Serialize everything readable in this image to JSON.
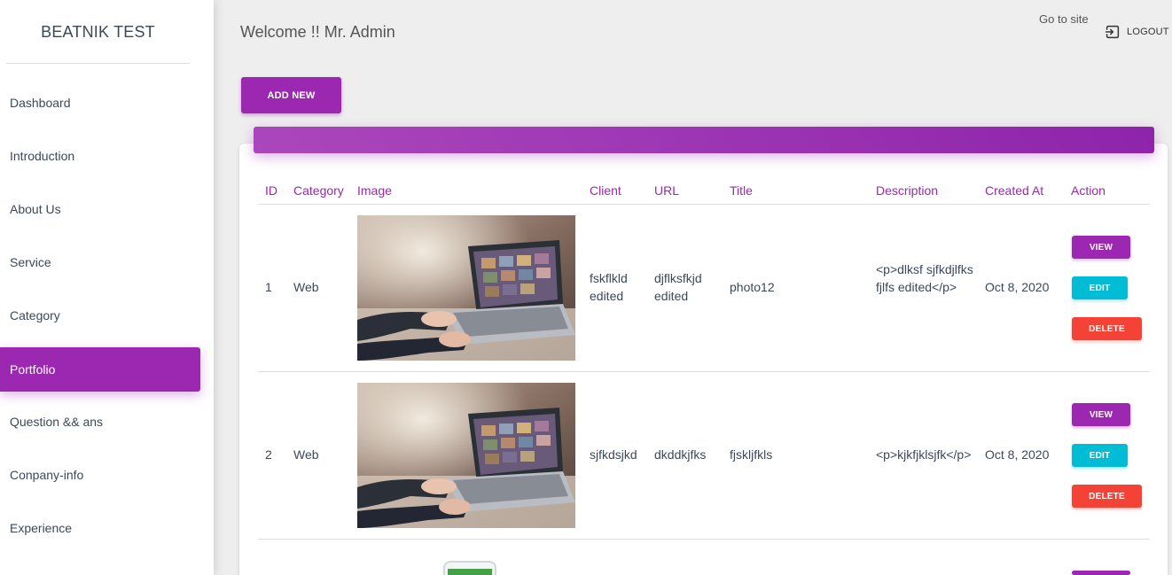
{
  "sidebar": {
    "brand": "BEATNIK TEST",
    "items": [
      {
        "label": "Dashboard"
      },
      {
        "label": "Introduction"
      },
      {
        "label": "About Us"
      },
      {
        "label": "Service"
      },
      {
        "label": "Category"
      },
      {
        "label": "Portfolio",
        "active": true
      },
      {
        "label": "Question && ans"
      },
      {
        "label": "Conpany-info"
      },
      {
        "label": "Experience"
      }
    ]
  },
  "header": {
    "welcome": "Welcome !! Mr. Admin",
    "goto_site": "Go to site",
    "logout": "LOGOUT"
  },
  "toolbar": {
    "add_new": "ADD NEW"
  },
  "table": {
    "columns": [
      "ID",
      "Category",
      "Image",
      "Client",
      "URL",
      "Title",
      "Description",
      "Created At",
      "Action"
    ],
    "rows": [
      {
        "id": "1",
        "category": "Web",
        "image": "laptop-photo",
        "client": "fskflkld edited",
        "url": "djflksfkjd edited",
        "title": "photo12",
        "description": "<p>dlksf sjfkdjlfks fjlfs edited</p>",
        "created_at": "Oct 8, 2020",
        "actions": {
          "view": "VIEW",
          "edit": "EDIT",
          "delete": "DELETE"
        }
      },
      {
        "id": "2",
        "category": "Web",
        "image": "laptop-photo",
        "client": "sjfkdsjkd",
        "url": "dkddkjfks",
        "title": "fjskljfkls",
        "description": "<p>kjkfjklsjfk</p>",
        "created_at": "Oct 8, 2020",
        "actions": {
          "view": "VIEW",
          "edit": "EDIT",
          "delete": "DELETE"
        }
      }
    ]
  },
  "colors": {
    "primary": "#9c27b0",
    "info": "#00bcd4",
    "danger": "#f44336",
    "background": "#eeeeee"
  }
}
